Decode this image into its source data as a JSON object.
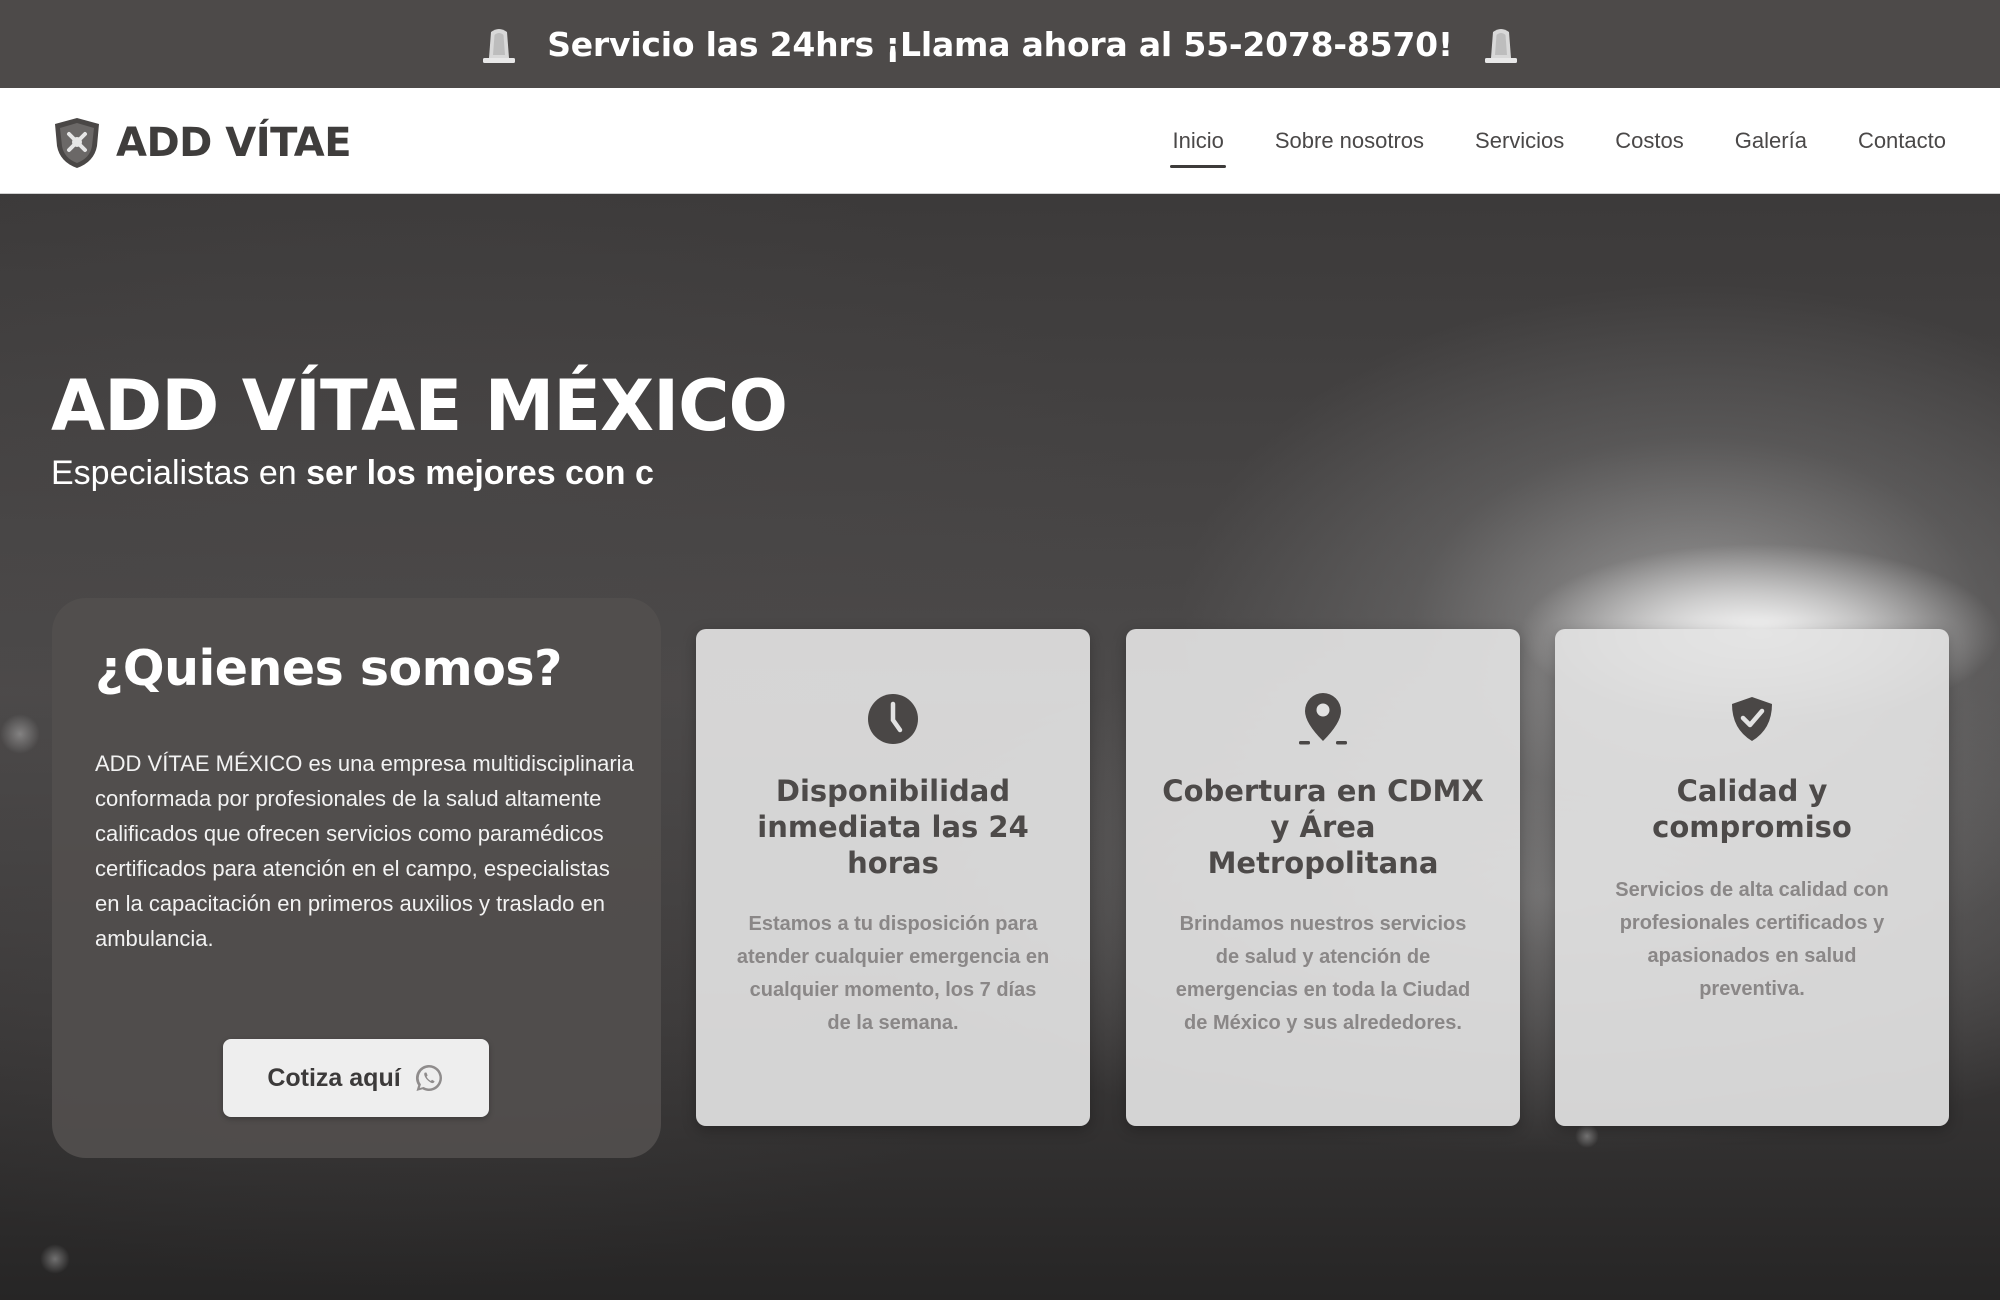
{
  "top_bar": {
    "promo_text": "Servicio las 24hrs ¡Llama ahora al 55-2078-8570!",
    "left_icon": "siren-icon",
    "right_icon": "siren-icon"
  },
  "header": {
    "brand_name": "ADD VÍTAE",
    "logo_icon": "shield-logo",
    "nav": [
      {
        "label": "Inicio",
        "active": true
      },
      {
        "label": "Sobre nosotros",
        "active": false
      },
      {
        "label": "Servicios",
        "active": false
      },
      {
        "label": "Costos",
        "active": false
      },
      {
        "label": "Galería",
        "active": false
      },
      {
        "label": "Contacto",
        "active": false
      }
    ]
  },
  "hero": {
    "title": "ADD VÍTAE MÉXICO",
    "subtitle_prefix": "Especialistas en ",
    "subtitle_emphasis": "ser los mejores con c"
  },
  "about": {
    "title": "¿Quienes somos?",
    "body": "ADD VÍTAE MÉXICO es una empresa multidisciplinaria conformada por profesionales de la salud altamente calificados que ofrecen servicios como paramédicos certificados para atención en el campo, especialistas en la capacitación en primeros auxilios y traslado en ambulancia.",
    "button_label": "Cotiza aquí",
    "button_icon": "whatsapp-icon"
  },
  "features": [
    {
      "icon": "clock-icon",
      "title": "Disponibilidad inmediata las 24 horas",
      "text": "Estamos a tu disposición para atender cualquier emergencia en cualquier momento, los 7 días de la semana."
    },
    {
      "icon": "location-pin-icon",
      "title": "Cobertura en CDMX y Área Metropolitana",
      "text": "Brindamos nuestros servicios de salud y atención de emergencias en toda la Ciudad de México y sus alrededores."
    },
    {
      "icon": "shield-check-icon",
      "title": "Calidad y compromiso",
      "text": "Servicios de alta calidad con profesionales certificados y apasionados en salud preventiva."
    }
  ],
  "colors": {
    "top_bar_bg": "#4d4a49",
    "header_bg": "#ffffff",
    "about_card_bg": "#524f4e",
    "feature_card_bg": "#e2e2e2",
    "feature_title": "#4d4a49",
    "feature_text": "#8a8787"
  }
}
